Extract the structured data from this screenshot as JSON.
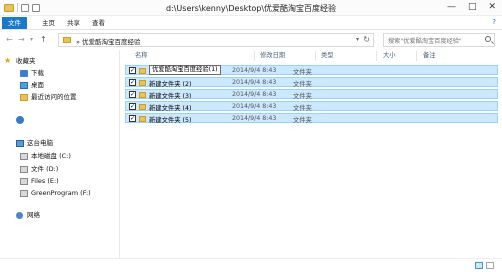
{
  "window": {
    "title": "d:\\Users\\kenny\\Desktop\\优爱酷淘宝百度经验",
    "controls": {
      "minimize": "—",
      "maximize": "□",
      "close": "✕"
    }
  },
  "ribbon": {
    "tabs": [
      "文件",
      "主页",
      "共享",
      "查看"
    ],
    "help": "?"
  },
  "nav_buttons": {
    "back": "←",
    "forward": "→",
    "recent": "▾",
    "up": "↑"
  },
  "address": {
    "breadcrumb": "» 优爱酷淘宝百度经验",
    "dropdown": "▾",
    "refresh": "↻"
  },
  "search": {
    "placeholder": "搜索\"优爱酷淘宝百度经验\""
  },
  "navpane": {
    "favorites": "收藏夹",
    "favorites_items": [
      "下载",
      "桌面",
      "最近访问的位置"
    ],
    "this_pc": "这台电脑",
    "drives": [
      "本地磁盘 (C:)",
      "文件 (D:)",
      "Files (E:)",
      "GreenProgram (F:)"
    ],
    "network": "网络"
  },
  "columns": {
    "name": "名称",
    "date": "修改日期",
    "type": "类型",
    "size": "大小",
    "note": "备注"
  },
  "rows": [
    {
      "name": "优爱酷淘宝百度经验(1)",
      "date": "2014/9/4 8:43",
      "type": "文件夹",
      "editing": true
    },
    {
      "name": "新建文件夹 (2)",
      "date": "2014/9/4 8:43",
      "type": "文件夹"
    },
    {
      "name": "新建文件夹 (3)",
      "date": "2014/9/4 8:43",
      "type": "文件夹"
    },
    {
      "name": "新建文件夹 (4)",
      "date": "2014/9/4 8:43",
      "type": "文件夹"
    },
    {
      "name": "新建文件夹 (5)",
      "date": "2014/9/4 8:43",
      "type": "文件夹"
    }
  ],
  "check_mark": "✓",
  "colors": {
    "selection": "#cce8ff",
    "selection_border": "#99d1ff",
    "file_tab": "#1979ca"
  }
}
